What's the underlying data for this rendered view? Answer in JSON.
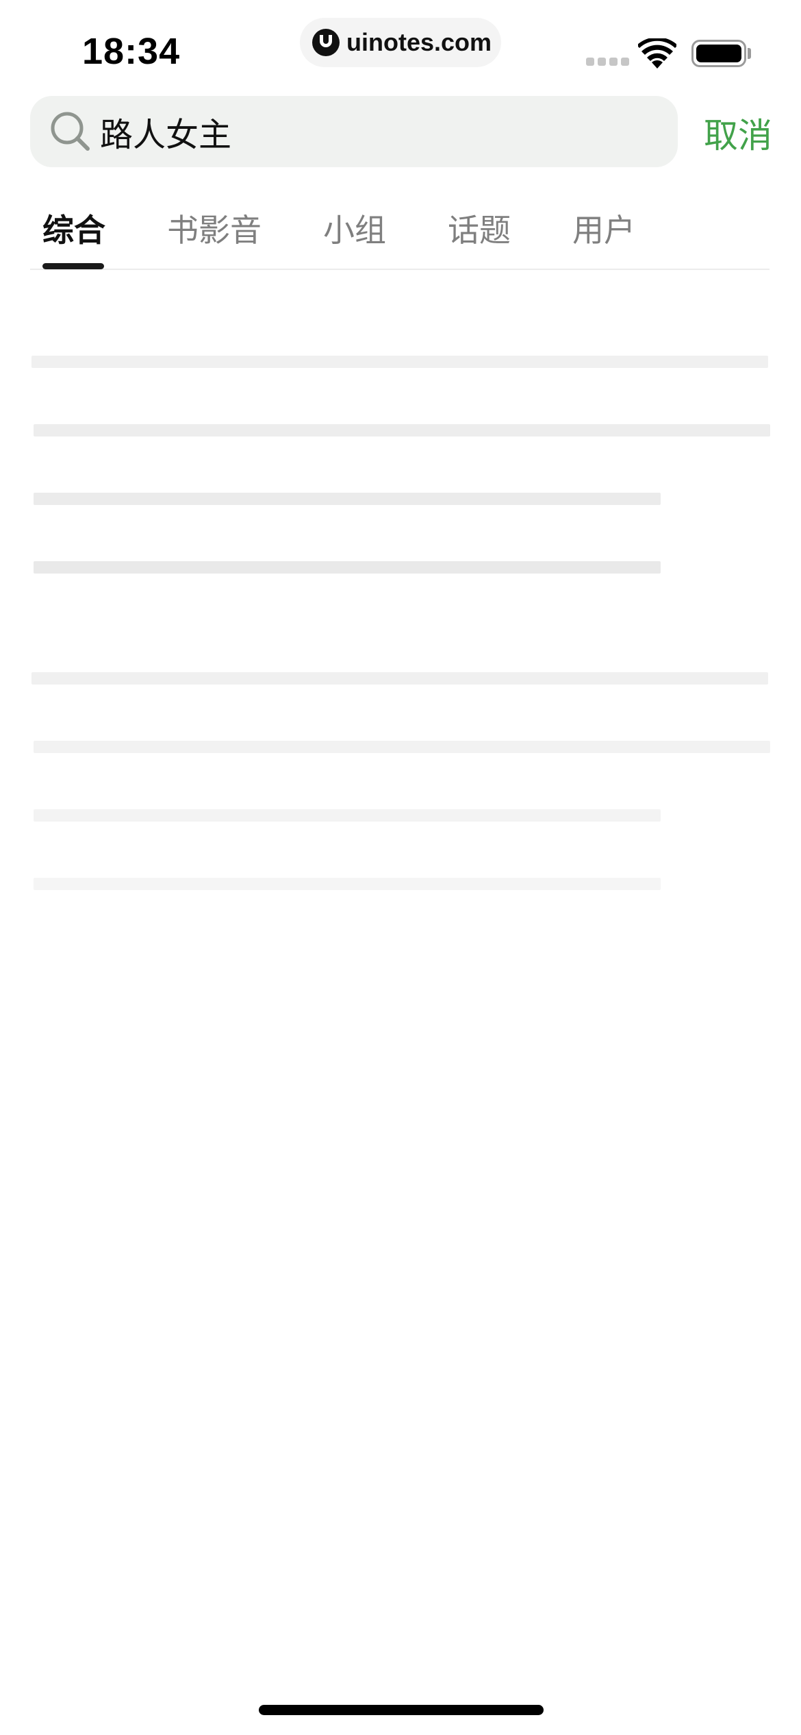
{
  "status_bar": {
    "time": "18:34",
    "watermark": "uinotes.com"
  },
  "search": {
    "query": "路人女主",
    "cancel_label": "取消"
  },
  "tabs": [
    {
      "label": "综合",
      "active": true
    },
    {
      "label": "书影音",
      "active": false
    },
    {
      "label": "小组",
      "active": false
    },
    {
      "label": "话题",
      "active": false
    },
    {
      "label": "用户",
      "active": false
    }
  ],
  "colors": {
    "accent": "#42a24a",
    "search_bg": "#f0f2f0",
    "skeleton": "#f0f0f0"
  },
  "icons": [
    "search-icon",
    "wifi-icon",
    "battery-icon",
    "signal-icon"
  ]
}
